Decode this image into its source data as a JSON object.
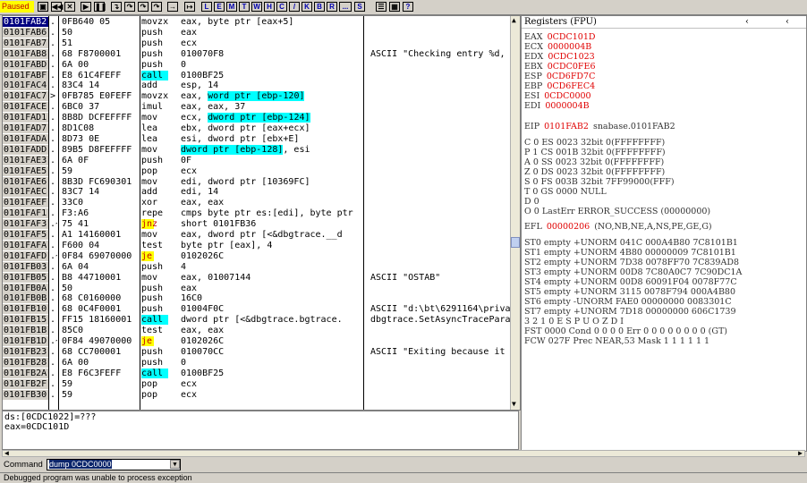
{
  "toolbar": {
    "status": "Paused",
    "letters": [
      "L",
      "E",
      "M",
      "T",
      "W",
      "H",
      "C",
      "/",
      "K",
      "B",
      "R",
      "...",
      "S"
    ]
  },
  "cpu_rows": [
    {
      "addr": "0101FAB2",
      "mk": ".",
      "hex": "0FB640 05",
      "dis": [
        [
          "movzx"
        ],
        [
          "eax, byte ptr [eax+5]"
        ]
      ],
      "cmt": "",
      "sel": true
    },
    {
      "addr": "0101FAB6",
      "mk": ".",
      "hex": "50",
      "dis": [
        [
          "push"
        ],
        [
          "eax"
        ]
      ],
      "cmt": ""
    },
    {
      "addr": "0101FAB7",
      "mk": ".",
      "hex": "51",
      "dis": [
        [
          "push"
        ],
        [
          "ecx"
        ]
      ],
      "cmt": ""
    },
    {
      "addr": "0101FAB8",
      "mk": ".",
      "hex": "68 F8700001",
      "dis": [
        [
          "push"
        ],
        [
          "010070F8"
        ]
      ],
      "cmt": "ASCII \"Checking entry %d,"
    },
    {
      "addr": "0101FABD",
      "mk": ".",
      "hex": "6A 00",
      "dis": [
        [
          "push"
        ],
        [
          "0"
        ]
      ],
      "cmt": ""
    },
    {
      "addr": "0101FABF",
      "mk": ".",
      "hex": "E8 61C4FEFF",
      "dis": [
        [
          "call",
          "call"
        ],
        [
          "0100BF25"
        ]
      ],
      "cmt": ""
    },
    {
      "addr": "0101FAC4",
      "mk": ".",
      "hex": "83C4 14",
      "dis": [
        [
          "add"
        ],
        [
          "esp, 14"
        ]
      ],
      "cmt": ""
    },
    {
      "addr": "0101FAC7",
      "mk": ">",
      "hex": "0FB785 E0FEFF",
      "dis": [
        [
          "movzx"
        ],
        [
          "eax, ",
          "word ptr [ebp-120]"
        ]
      ],
      "cmt": ""
    },
    {
      "addr": "0101FACE",
      "mk": ".",
      "hex": "6BC0 37",
      "dis": [
        [
          "imul"
        ],
        [
          "eax, eax, 37"
        ]
      ],
      "cmt": ""
    },
    {
      "addr": "0101FAD1",
      "mk": ".",
      "hex": "8B8D DCFEFFFF",
      "dis": [
        [
          "mov"
        ],
        [
          "ecx, ",
          "dword ptr [ebp-124]"
        ]
      ],
      "cmt": ""
    },
    {
      "addr": "0101FAD7",
      "mk": ".",
      "hex": "8D1C08",
      "dis": [
        [
          "lea"
        ],
        [
          "ebx, dword ptr [eax+ecx]"
        ]
      ],
      "cmt": ""
    },
    {
      "addr": "0101FADA",
      "mk": ".",
      "hex": "8D73 0E",
      "dis": [
        [
          "lea"
        ],
        [
          "esi, dword ptr [ebx+E]"
        ]
      ],
      "cmt": ""
    },
    {
      "addr": "0101FADD",
      "mk": ".",
      "hex": "89B5 D8FEFFFF",
      "dis": [
        [
          "mov"
        ],
        [
          "",
          "dword ptr [ebp-128]",
          ", esi"
        ]
      ],
      "cmt": ""
    },
    {
      "addr": "0101FAE3",
      "mk": ".",
      "hex": "6A 0F",
      "dis": [
        [
          "push"
        ],
        [
          "0F"
        ]
      ],
      "cmt": ""
    },
    {
      "addr": "0101FAE5",
      "mk": ".",
      "hex": "59",
      "dis": [
        [
          "pop"
        ],
        [
          "ecx"
        ]
      ],
      "cmt": ""
    },
    {
      "addr": "0101FAE6",
      "mk": ".",
      "hex": "8B3D FC690301",
      "dis": [
        [
          "mov"
        ],
        [
          "edi, dword ptr [10369FC]"
        ]
      ],
      "cmt": ""
    },
    {
      "addr": "0101FAEC",
      "mk": ".",
      "hex": "83C7 14",
      "dis": [
        [
          "add"
        ],
        [
          "edi, 14"
        ]
      ],
      "cmt": ""
    },
    {
      "addr": "0101FAEF",
      "mk": ".",
      "hex": "33C0",
      "dis": [
        [
          "xor"
        ],
        [
          "eax, eax"
        ]
      ],
      "cmt": ""
    },
    {
      "addr": "0101FAF1",
      "mk": ".",
      "hex": "F3:A6",
      "dis": [
        [
          "repe"
        ],
        [
          "cmps byte ptr es:[edi], byte ptr"
        ]
      ],
      "cmt": ""
    },
    {
      "addr": "0101FAF3",
      "mk": ".~",
      "hex": "75 41",
      "dis": [
        [
          "jnz",
          "jump"
        ],
        [
          "short 0101FB36"
        ]
      ],
      "cmt": ""
    },
    {
      "addr": "0101FAF5",
      "mk": ".",
      "hex": "A1 14160001",
      "dis": [
        [
          "mov"
        ],
        [
          "eax, dword ptr [<&dbgtrace.__d"
        ]
      ],
      "cmt": ""
    },
    {
      "addr": "0101FAFA",
      "mk": ".",
      "hex": "F600 04",
      "dis": [
        [
          "test"
        ],
        [
          "byte ptr [eax], 4"
        ]
      ],
      "cmt": ""
    },
    {
      "addr": "0101FAFD",
      "mk": ".~",
      "hex": "0F84 69070000",
      "dis": [
        [
          "je",
          "jump"
        ],
        [
          "0102026C"
        ]
      ],
      "cmt": ""
    },
    {
      "addr": "0101FB03",
      "mk": ".",
      "hex": "6A 04",
      "dis": [
        [
          "push"
        ],
        [
          "4"
        ]
      ],
      "cmt": ""
    },
    {
      "addr": "0101FB05",
      "mk": ".",
      "hex": "B8 44710001",
      "dis": [
        [
          "mov"
        ],
        [
          "eax, 01007144"
        ]
      ],
      "cmt": "ASCII \"OSTAB\""
    },
    {
      "addr": "0101FB0A",
      "mk": ".",
      "hex": "50",
      "dis": [
        [
          "push"
        ],
        [
          "eax"
        ]
      ],
      "cmt": ""
    },
    {
      "addr": "0101FB0B",
      "mk": ".",
      "hex": "68 C0160000",
      "dis": [
        [
          "push"
        ],
        [
          "16C0"
        ]
      ],
      "cmt": ""
    },
    {
      "addr": "0101FB10",
      "mk": ".",
      "hex": "68 0C4F0001",
      "dis": [
        [
          "push"
        ],
        [
          "01004F0C"
        ]
      ],
      "cmt": "ASCII \"d:\\bt\\6291164\\priva"
    },
    {
      "addr": "0101FB15",
      "mk": ".",
      "hex": "FF15 18160001",
      "dis": [
        [
          "call",
          "call"
        ],
        [
          "dword ptr [<&dbgtrace.bgtrace."
        ]
      ],
      "cmt": "dbgtrace.SetAsyncTracePara"
    },
    {
      "addr": "0101FB1B",
      "mk": ".",
      "hex": "85C0",
      "dis": [
        [
          "test"
        ],
        [
          "eax, eax"
        ]
      ],
      "cmt": ""
    },
    {
      "addr": "0101FB1D",
      "mk": ".~",
      "hex": "0F84 49070000",
      "dis": [
        [
          "je",
          "jump"
        ],
        [
          "0102026C"
        ]
      ],
      "cmt": ""
    },
    {
      "addr": "0101FB23",
      "mk": ".",
      "hex": "68 CC700001",
      "dis": [
        [
          "push"
        ],
        [
          "010070CC"
        ]
      ],
      "cmt": "ASCII \"Exiting because it"
    },
    {
      "addr": "0101FB28",
      "mk": ".",
      "hex": "6A 00",
      "dis": [
        [
          "push"
        ],
        [
          "0"
        ]
      ],
      "cmt": ""
    },
    {
      "addr": "0101FB2A",
      "mk": ".",
      "hex": "E8 F6C3FEFF",
      "dis": [
        [
          "call",
          "call"
        ],
        [
          "0100BF25"
        ]
      ],
      "cmt": ""
    },
    {
      "addr": "0101FB2F",
      "mk": ".",
      "hex": "59",
      "dis": [
        [
          "pop"
        ],
        [
          "ecx"
        ]
      ],
      "cmt": ""
    },
    {
      "addr": "0101FB30",
      "mk": ".",
      "hex": "59",
      "dis": [
        [
          "pop"
        ],
        [
          "ecx"
        ]
      ],
      "cmt": ""
    }
  ],
  "info": {
    "line1": "ds:[0CDC1022]=???",
    "line2": "eax=0CDC101D"
  },
  "registers": {
    "title": "Registers (FPU)",
    "gp": [
      {
        "name": "EAX",
        "val": "0CDC101D",
        "extra": ""
      },
      {
        "name": "ECX",
        "val": "0000004B",
        "extra": ""
      },
      {
        "name": "EDX",
        "val": "0CDC1023",
        "extra": ""
      },
      {
        "name": "EBX",
        "val": "0CDC0FE6",
        "extra": ""
      },
      {
        "name": "ESP",
        "val": "0CD6FD7C",
        "extra": ""
      },
      {
        "name": "EBP",
        "val": "0CD6FEC4",
        "extra": ""
      },
      {
        "name": "ESI",
        "val": "0CDC0000",
        "extra": ""
      },
      {
        "name": "EDI",
        "val": "0000004B",
        "extra": ""
      }
    ],
    "eip": {
      "name": "EIP",
      "val": "0101FAB2",
      "extra": "snabase.0101FAB2"
    },
    "flags": [
      "C 0  ES 0023 32bit 0(FFFFFFFF)",
      "P 1  CS 001B 32bit 0(FFFFFFFF)",
      "A 0  SS 0023 32bit 0(FFFFFFFF)",
      "Z 0  DS 0023 32bit 0(FFFFFFFF)",
      "S 0  FS 003B 32bit 7FF99000(FFF)",
      "T 0  GS 0000 NULL",
      "D 0",
      "O 0  LastErr ERROR_SUCCESS (00000000)"
    ],
    "efl": {
      "name": "EFL",
      "val": "00000206",
      "extra": "(NO,NB,NE,A,NS,PE,GE,G)"
    },
    "fpu": [
      "ST0 empty +UNORM 041C 000A4B80 7C8101B1",
      "ST1 empty +UNORM 4B80 00000009 7C8101B1",
      "ST2 empty +UNORM 7D38 0078FF70 7C839AD8",
      "ST3 empty +UNORM 00D8 7C80A0C7 7C90DC1A",
      "ST4 empty +UNORM 00D8 60091F04 0078F77C",
      "ST5 empty +UNORM 3115 0078F794 000A4B80",
      "ST6 empty -UNORM FAE0 00000000 0083301C",
      "ST7 empty +UNORM 7D18 00000000 606C1739"
    ],
    "fpu_hdr": "           3 2 1 0       E S P U O Z D I",
    "fst": "FST 0000  Cond 0 0 0 0  Err 0 0 0 0 0 0 0 0  (GT)",
    "fcw": "FCW 027F  Prec NEAR,53  Mask    1 1 1 1 1 1"
  },
  "command": {
    "label": "Command",
    "value": "dump 0CDC0000"
  },
  "statusbar": "Debugged program was unable to process exception",
  "colors": {
    "panel": "#d4d0c8",
    "red": "#e00000",
    "cyan": "#00ffff",
    "yellow": "#ffff00"
  }
}
